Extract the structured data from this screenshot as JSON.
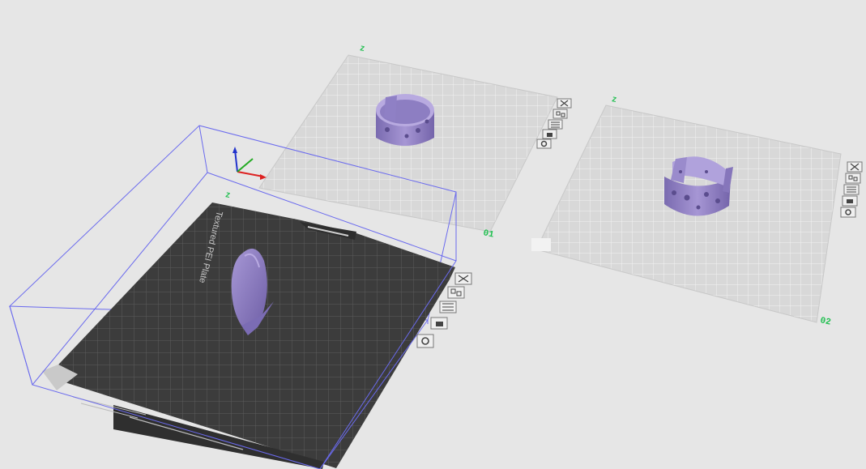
{
  "app": {
    "view": "3D plate view"
  },
  "plates": [
    {
      "id": "plate-0",
      "active": true,
      "label": "",
      "corner_mark": "Z",
      "surface_text": "Textured PEI Plate",
      "colors": {
        "surface": "#3b3b3b",
        "grid": "#5a5a5a",
        "box": "#6a6aee"
      }
    },
    {
      "id": "plate-1",
      "active": false,
      "label": "01",
      "corner_mark": "Z",
      "colors": {
        "surface": "#d7d7d7",
        "grid": "#f4f4f4"
      }
    },
    {
      "id": "plate-2",
      "active": false,
      "label": "02",
      "corner_mark": "Z",
      "colors": {
        "surface": "#d7d7d7",
        "grid": "#f4f4f4"
      }
    }
  ],
  "plate_tools": [
    {
      "name": "remove-plate",
      "icon": "close-icon"
    },
    {
      "name": "arrange-plate",
      "icon": "arrange-icon"
    },
    {
      "name": "orient-plate",
      "icon": "orient-icon"
    },
    {
      "name": "lock-plate",
      "icon": "lock-icon"
    },
    {
      "name": "plate-settings",
      "icon": "settings-icon"
    }
  ],
  "models": [
    {
      "name": "cup-model-plate-1",
      "color": "#9b8cc8"
    },
    {
      "name": "cup-model-plate-2",
      "color": "#9b8cc8"
    },
    {
      "name": "leaf-model-plate-0",
      "color": "#8e7fbf"
    }
  ],
  "axes": {
    "x_color": "#d22",
    "y_color": "#2a2",
    "z_color": "#22c"
  }
}
